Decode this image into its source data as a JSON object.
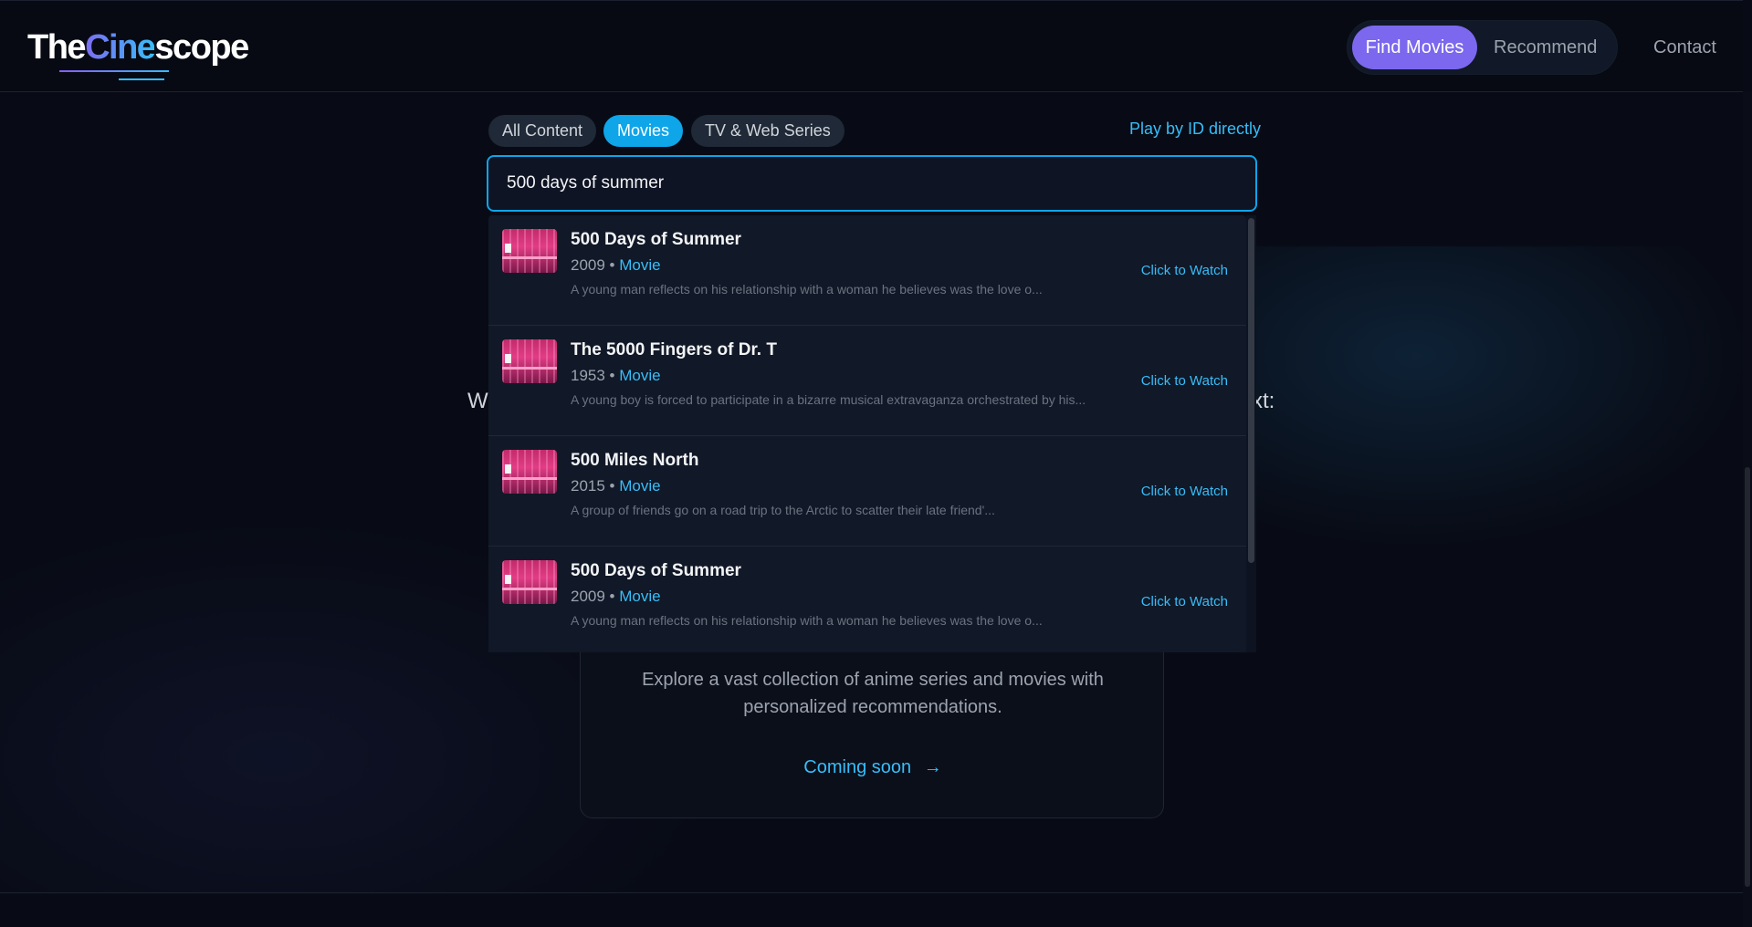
{
  "brand": {
    "logo_part1": "The",
    "logo_part2": "Cine",
    "logo_part3": "scope"
  },
  "nav": {
    "find": "Find Movies",
    "recommend": "Recommend",
    "contact": "Contact"
  },
  "filters": {
    "tabs": [
      {
        "label": "All Content",
        "active": false
      },
      {
        "label": "Movies",
        "active": true
      },
      {
        "label": "TV & Web Series",
        "active": false
      }
    ],
    "play_by_id": "Play by ID directly"
  },
  "search": {
    "value": "500 days of summer"
  },
  "results": [
    {
      "title": "500 Days of Summer",
      "year": "2009",
      "type": "Movie",
      "description": "A young man reflects on his relationship with a woman he believes was the love o...",
      "action": "Click to Watch"
    },
    {
      "title": "The 5000 Fingers of Dr. T",
      "year": "1953",
      "type": "Movie",
      "description": "A young boy is forced to participate in a bizarre musical extravaganza orchestrated by his...",
      "action": "Click to Watch"
    },
    {
      "title": "500 Miles North",
      "year": "2015",
      "type": "Movie",
      "description": "A group of friends go on a road trip to the Arctic to scatter their late friend'...",
      "action": "Click to Watch"
    },
    {
      "title": "500 Days of Summer",
      "year": "2009",
      "type": "Movie",
      "description": "A young man reflects on his relationship with a woman he believes was the love o...",
      "action": "Click to Watch"
    }
  ],
  "background": {
    "partial_left": "W",
    "partial_right": "xt:",
    "card_description": "Explore a vast collection of anime series and movies with personalized recommendations.",
    "card_cta": "Coming soon",
    "card_cta_arrow": "→"
  },
  "colors": {
    "accent": "#0ea5e9",
    "nav_active": "#7b68ee",
    "link": "#38bdf8",
    "background": "#080b15"
  }
}
